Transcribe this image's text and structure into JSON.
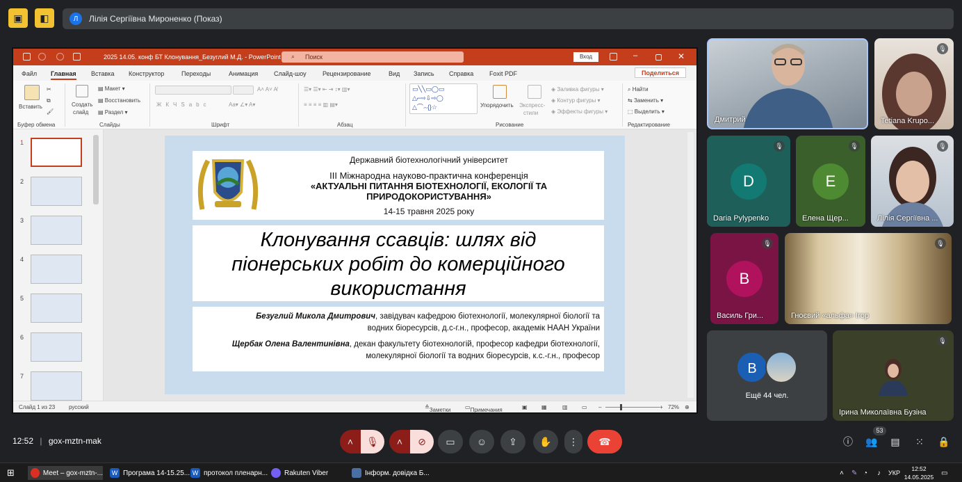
{
  "top": {
    "presenter_name": "Лілія Сергіївна Мироненко (Показ)",
    "presenter_initial": "Л"
  },
  "ppt": {
    "title": "2025 14.05. конф БТ Клонування_Безуглий М.Д.  -  PowerPoint",
    "search_placeholder": "Поиск",
    "login": "Вход",
    "menu": [
      "Файл",
      "Главная",
      "Вставка",
      "Конструктор",
      "Переходы",
      "Анимация",
      "Слайд-шоу",
      "Рецензирование",
      "Вид",
      "Запись",
      "Справка",
      "Foxit PDF"
    ],
    "share": "Поделиться",
    "ribbon": {
      "insert": "Вставить",
      "clipboard": "Буфер обмена",
      "create_slide": "Создать",
      "slide_word": "слайд",
      "layout": "Макет",
      "restore": "Восстановить",
      "section": "Раздел",
      "slides_group": "Слайды",
      "font_group": "Шрифт",
      "paragraph_group": "Абзац",
      "arrange": "Упорядочить",
      "express_styles": "Экспресс-",
      "styles_word": "стили",
      "fill": "Заливка фигуры",
      "outline": "Контур фигуры",
      "effects": "Эффекты фигуры",
      "drawing_group": "Рисование",
      "find": "Найти",
      "replace": "Заменить",
      "select": "Выделить",
      "editing_group": "Редактирование"
    },
    "thumb_numbers": [
      "1",
      "2",
      "3",
      "4",
      "5",
      "6",
      "7"
    ],
    "slide": {
      "univ": "Державний біотехнологічний університет",
      "conf1": "ІІІ Міжнародна науково-практична конференція",
      "conf2": "«АКТУАЛЬНІ ПИТАННЯ БІОТЕХНОЛОГІЇ, ЕКОЛОГІЇ ТА",
      "conf3": "ПРИРОДОКОРИСТУВАННЯ»",
      "dates": "14-15 травня 2025 року",
      "title1": "Клонування ссавців: шлях від",
      "title2": "піонерських робіт до комерційного",
      "title3": "використання",
      "a1_name": "Безуглий Микола Дмитрович",
      "a1_rest1": ", завідувач кафедрою біотехнології, молекулярної біології та",
      "a1_rest2": "водних біоресурсів,  д.с-г.н., професор, академік НААН України",
      "a2_name": "Щербак Олена Валентинівна",
      "a2_rest1": ", декан факультету біотехнологій, професор кафедри біотехнології,",
      "a2_rest2": "молекулярної біології та водних біоресурсів, к.с.-г.н., професор"
    },
    "status": {
      "slide": "Слайд 1 из 23",
      "lang": "русский",
      "notes": "Заметки",
      "comments": "Примечания",
      "zoom": "72%"
    }
  },
  "participants": [
    {
      "name": "Дмитрий"
    },
    {
      "name": "Tetiana Krupo..."
    },
    {
      "name": "Daria Pylypenko",
      "initial": "D"
    },
    {
      "name": "Елена Щер...",
      "initial": "E"
    },
    {
      "name": "Лілія Сергіївна ..."
    },
    {
      "name": "Василь Гри...",
      "initial": "B"
    },
    {
      "name": "Гноєвий «альфа» Ігор"
    },
    {
      "name": "Ещё 44 чел.",
      "initial": "B"
    },
    {
      "name": "Ірина Миколаївна Бузіна"
    }
  ],
  "meeting": {
    "time": "12:52",
    "code": "gox-mztn-mak",
    "people_badge": "53"
  },
  "taskbar": {
    "items": [
      "Meet – gox-mztn-...",
      "Програма 14-15.25...",
      "протокол пленарн...",
      "Rakuten Viber",
      "Інформ. довідка Б..."
    ],
    "lang": "УКР",
    "time": "12:52",
    "date": "14.05.2025"
  },
  "colors": {
    "accent_red": "#c43e1c",
    "end_call": "#ea4335",
    "teal": "#1e5f5a",
    "green": "#3a5f2a",
    "magenta": "#7a1445"
  }
}
